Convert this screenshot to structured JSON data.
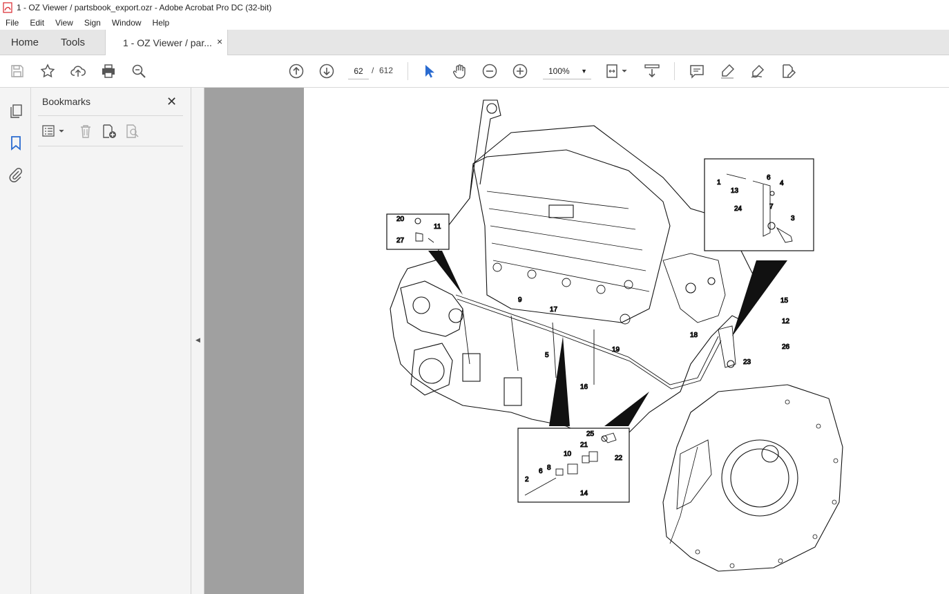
{
  "window": {
    "title": "1 - OZ Viewer / partsbook_export.ozr - Adobe Acrobat Pro DC (32-bit)"
  },
  "menu": [
    "File",
    "Edit",
    "View",
    "Sign",
    "Window",
    "Help"
  ],
  "tabs": {
    "home": "Home",
    "tools": "Tools",
    "doc": "1 - OZ Viewer / par...",
    "close": "×"
  },
  "toolbar": {
    "page_current": "62",
    "page_sep": "/",
    "page_total": "612",
    "zoom": "100%",
    "icons": [
      "save-icon",
      "star-icon",
      "upload-icon",
      "print-icon",
      "zoom-search-icon",
      "page-up-icon",
      "page-down-icon",
      "select-arrow-icon",
      "hand-icon",
      "zoom-out-icon",
      "zoom-in-icon",
      "fit-page-icon",
      "scroll-mode-icon",
      "comment-icon",
      "highlight-icon",
      "sign-icon",
      "edit-pdf-icon"
    ]
  },
  "bookmarks_panel": {
    "title": "Bookmarks",
    "close": "✕"
  },
  "diagram": {
    "callouts": [
      "1",
      "13",
      "6",
      "4",
      "24",
      "7",
      "3",
      "20",
      "11",
      "27",
      "9",
      "17",
      "15",
      "12",
      "18",
      "26",
      "23",
      "5",
      "19",
      "16",
      "25",
      "21",
      "22",
      "10",
      "8",
      "6",
      "2",
      "14"
    ]
  },
  "colors": {
    "accent": "#2a6bd0",
    "page_bg": "#a0a0a0"
  }
}
